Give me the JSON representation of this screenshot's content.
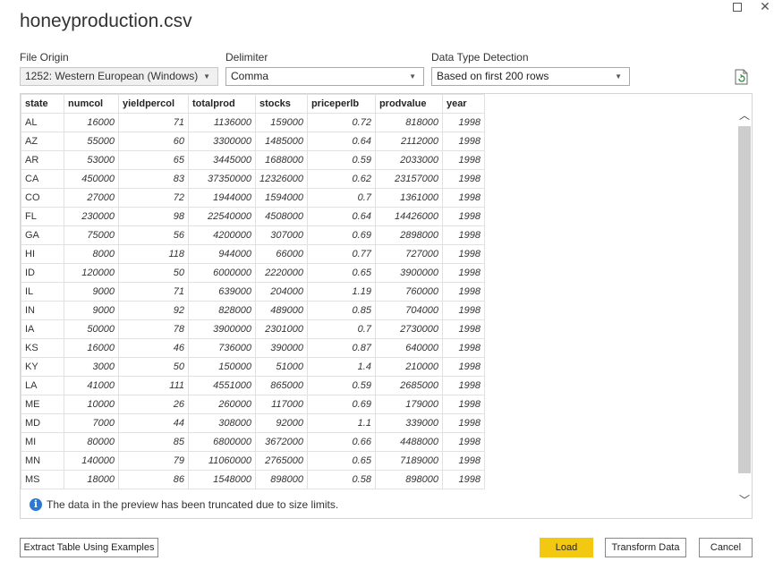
{
  "dialog": {
    "title": "honeyproduction.csv"
  },
  "options": {
    "file_origin": {
      "label": "File Origin",
      "value": "1252: Western European (Windows)"
    },
    "delimiter": {
      "label": "Delimiter",
      "value": "Comma"
    },
    "data_type_detection": {
      "label": "Data Type Detection",
      "value": "Based on first 200 rows"
    }
  },
  "table": {
    "columns": [
      "state",
      "numcol",
      "yieldpercol",
      "totalprod",
      "stocks",
      "priceperlb",
      "prodvalue",
      "year"
    ],
    "rows": [
      [
        "AL",
        "16000",
        "71",
        "1136000",
        "159000",
        "0.72",
        "818000",
        "1998"
      ],
      [
        "AZ",
        "55000",
        "60",
        "3300000",
        "1485000",
        "0.64",
        "2112000",
        "1998"
      ],
      [
        "AR",
        "53000",
        "65",
        "3445000",
        "1688000",
        "0.59",
        "2033000",
        "1998"
      ],
      [
        "CA",
        "450000",
        "83",
        "37350000",
        "12326000",
        "0.62",
        "23157000",
        "1998"
      ],
      [
        "CO",
        "27000",
        "72",
        "1944000",
        "1594000",
        "0.7",
        "1361000",
        "1998"
      ],
      [
        "FL",
        "230000",
        "98",
        "22540000",
        "4508000",
        "0.64",
        "14426000",
        "1998"
      ],
      [
        "GA",
        "75000",
        "56",
        "4200000",
        "307000",
        "0.69",
        "2898000",
        "1998"
      ],
      [
        "HI",
        "8000",
        "118",
        "944000",
        "66000",
        "0.77",
        "727000",
        "1998"
      ],
      [
        "ID",
        "120000",
        "50",
        "6000000",
        "2220000",
        "0.65",
        "3900000",
        "1998"
      ],
      [
        "IL",
        "9000",
        "71",
        "639000",
        "204000",
        "1.19",
        "760000",
        "1998"
      ],
      [
        "IN",
        "9000",
        "92",
        "828000",
        "489000",
        "0.85",
        "704000",
        "1998"
      ],
      [
        "IA",
        "50000",
        "78",
        "3900000",
        "2301000",
        "0.7",
        "2730000",
        "1998"
      ],
      [
        "KS",
        "16000",
        "46",
        "736000",
        "390000",
        "0.87",
        "640000",
        "1998"
      ],
      [
        "KY",
        "3000",
        "50",
        "150000",
        "51000",
        "1.4",
        "210000",
        "1998"
      ],
      [
        "LA",
        "41000",
        "111",
        "4551000",
        "865000",
        "0.59",
        "2685000",
        "1998"
      ],
      [
        "ME",
        "10000",
        "26",
        "260000",
        "117000",
        "0.69",
        "179000",
        "1998"
      ],
      [
        "MD",
        "7000",
        "44",
        "308000",
        "92000",
        "1.1",
        "339000",
        "1998"
      ],
      [
        "MI",
        "80000",
        "85",
        "6800000",
        "3672000",
        "0.66",
        "4488000",
        "1998"
      ],
      [
        "MN",
        "140000",
        "79",
        "11060000",
        "2765000",
        "0.65",
        "7189000",
        "1998"
      ],
      [
        "MS",
        "18000",
        "86",
        "1548000",
        "898000",
        "0.58",
        "898000",
        "1998"
      ]
    ]
  },
  "notice": {
    "icon": "info-icon",
    "text": "The data in the preview has been truncated due to size limits."
  },
  "buttons": {
    "extract": "Extract Table Using Examples",
    "load": "Load",
    "transform": "Transform Data",
    "cancel": "Cancel"
  },
  "colors": {
    "primary": "#f2c811",
    "info": "#2b79d1"
  }
}
